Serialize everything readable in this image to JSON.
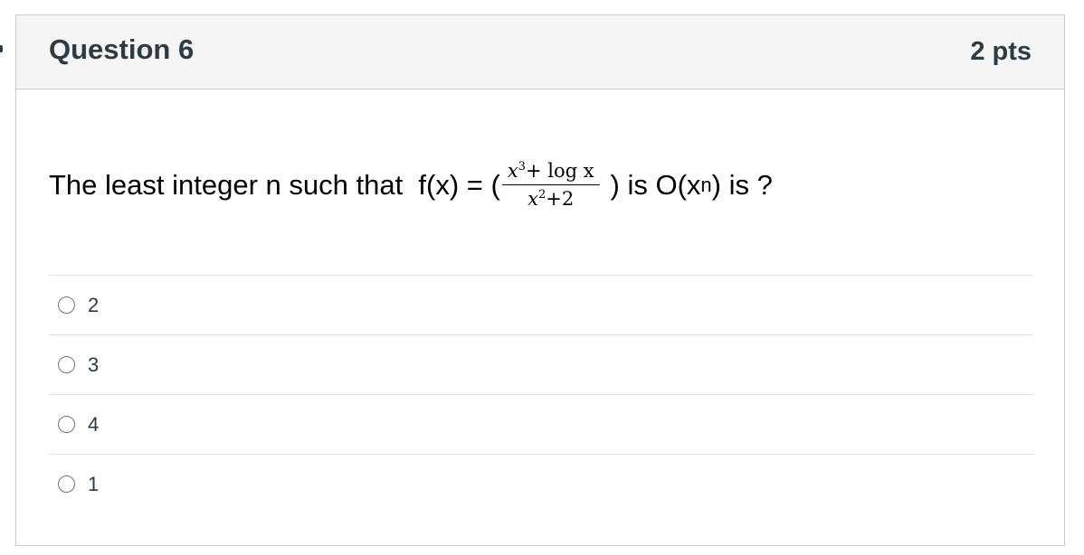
{
  "question": {
    "title": "Question 6",
    "points": "2 pts",
    "text_before": "The least integer n such that  f(x) = (",
    "fraction_numerator_base": "x",
    "fraction_numerator_exp": "3",
    "fraction_numerator_rest": "+ log x",
    "fraction_denominator_base": "x",
    "fraction_denominator_exp": "2",
    "fraction_denominator_rest": "+2",
    "text_after_1": ") is O(x",
    "text_superscript": "n",
    "text_after_2": ") is ?"
  },
  "answers": [
    {
      "label": "2"
    },
    {
      "label": "3"
    },
    {
      "label": "4"
    },
    {
      "label": "1"
    }
  ]
}
